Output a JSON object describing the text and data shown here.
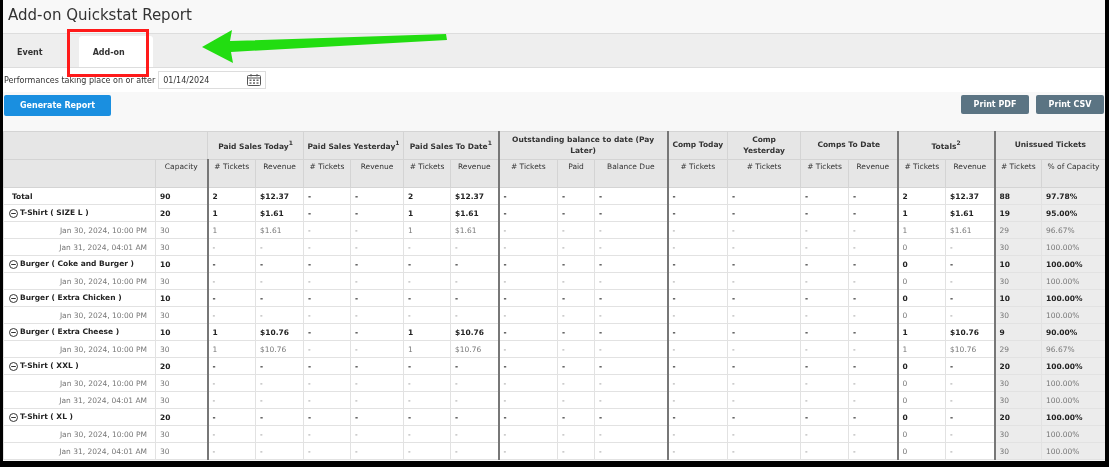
{
  "title": "Add-on Quickstat Report",
  "tabs": [
    {
      "label": "Event",
      "selected": false
    },
    {
      "label": "Add-on",
      "selected": true
    }
  ],
  "date_filter": {
    "label": "Performances taking place on or after",
    "value": "01/14/2024"
  },
  "generate_button": "Generate Report",
  "print_buttons": [
    "Print PDF",
    "Print CSV"
  ],
  "table": {
    "lead_column": "Capacity",
    "groups": [
      {
        "label": "Paid Sales Today$^{1}$",
        "columns": [
          "# Tickets",
          "Revenue"
        ]
      },
      {
        "label": "Paid Sales Yesterday$^{1}$",
        "columns": [
          "# Tickets",
          "Revenue"
        ]
      },
      {
        "label": "Paid Sales To Date$^{1}$",
        "columns": [
          "# Tickets",
          "Revenue"
        ]
      },
      {
        "label": "Outstanding balance to date (Pay Later)",
        "columns": [
          "# Tickets",
          "Paid",
          "Balance Due"
        ]
      },
      {
        "label": "Comp Today",
        "columns": [
          "# Tickets"
        ]
      },
      {
        "label": "Comp Yesterday",
        "columns": [
          "# Tickets"
        ]
      },
      {
        "label": "Comps To Date",
        "columns": [
          "# Tickets",
          "Revenue"
        ]
      },
      {
        "label": "Totals$^{2}$",
        "columns": [
          "# Tickets",
          "Revenue"
        ]
      },
      {
        "label": "Unissued Tickets",
        "columns": [
          "# Tickets",
          "% of Capacity"
        ]
      }
    ],
    "rows": [
      {
        "kind": "total",
        "name": "Total",
        "capacity": "90",
        "values": [
          "2",
          "$12.37",
          "-",
          "-",
          "2",
          "$12.37",
          "-",
          "-",
          "-",
          "-",
          "-",
          "-",
          "-",
          "2",
          "$12.37",
          "88",
          "97.78%"
        ]
      },
      {
        "kind": "item",
        "expanded": true,
        "name": "T-Shirt ( SIZE L )",
        "capacity": "20",
        "values": [
          "1",
          "$1.61",
          "-",
          "-",
          "1",
          "$1.61",
          "-",
          "-",
          "-",
          "-",
          "-",
          "-",
          "-",
          "1",
          "$1.61",
          "19",
          "95.00%"
        ]
      },
      {
        "kind": "performance",
        "name": "Jan 30, 2024, 10:00 PM",
        "capacity": "30",
        "values": [
          "1",
          "$1.61",
          "-",
          "-",
          "1",
          "$1.61",
          "-",
          "-",
          "-",
          "-",
          "-",
          "-",
          "-",
          "1",
          "$1.61",
          "29",
          "96.67%"
        ]
      },
      {
        "kind": "performance",
        "name": "Jan 31, 2024, 04:01 AM",
        "capacity": "30",
        "values": [
          "-",
          "-",
          "-",
          "-",
          "-",
          "-",
          "-",
          "-",
          "-",
          "-",
          "-",
          "-",
          "-",
          "0",
          "-",
          "30",
          "100.00%"
        ]
      },
      {
        "kind": "item",
        "expanded": true,
        "name": "Burger ( Coke and Burger )",
        "capacity": "10",
        "values": [
          "-",
          "-",
          "-",
          "-",
          "-",
          "-",
          "-",
          "-",
          "-",
          "-",
          "-",
          "-",
          "-",
          "0",
          "-",
          "10",
          "100.00%"
        ]
      },
      {
        "kind": "performance",
        "name": "Jan 30, 2024, 10:00 PM",
        "capacity": "30",
        "values": [
          "-",
          "-",
          "-",
          "-",
          "-",
          "-",
          "-",
          "-",
          "-",
          "-",
          "-",
          "-",
          "-",
          "0",
          "-",
          "30",
          "100.00%"
        ]
      },
      {
        "kind": "item",
        "expanded": true,
        "name": "Burger ( Extra Chicken )",
        "capacity": "10",
        "values": [
          "-",
          "-",
          "-",
          "-",
          "-",
          "-",
          "-",
          "-",
          "-",
          "-",
          "-",
          "-",
          "-",
          "0",
          "-",
          "10",
          "100.00%"
        ]
      },
      {
        "kind": "performance",
        "name": "Jan 30, 2024, 10:00 PM",
        "capacity": "30",
        "values": [
          "-",
          "-",
          "-",
          "-",
          "-",
          "-",
          "-",
          "-",
          "-",
          "-",
          "-",
          "-",
          "-",
          "0",
          "-",
          "30",
          "100.00%"
        ]
      },
      {
        "kind": "item",
        "expanded": true,
        "name": "Burger ( Extra Cheese )",
        "capacity": "10",
        "values": [
          "1",
          "$10.76",
          "-",
          "-",
          "1",
          "$10.76",
          "-",
          "-",
          "-",
          "-",
          "-",
          "-",
          "-",
          "1",
          "$10.76",
          "9",
          "90.00%"
        ]
      },
      {
        "kind": "performance",
        "name": "Jan 30, 2024, 10:00 PM",
        "capacity": "30",
        "values": [
          "1",
          "$10.76",
          "-",
          "-",
          "1",
          "$10.76",
          "-",
          "-",
          "-",
          "-",
          "-",
          "-",
          "-",
          "1",
          "$10.76",
          "29",
          "96.67%"
        ]
      },
      {
        "kind": "item",
        "expanded": true,
        "name": "T-Shirt ( XXL )",
        "capacity": "20",
        "values": [
          "-",
          "-",
          "-",
          "-",
          "-",
          "-",
          "-",
          "-",
          "-",
          "-",
          "-",
          "-",
          "-",
          "0",
          "-",
          "20",
          "100.00%"
        ]
      },
      {
        "kind": "performance",
        "name": "Jan 30, 2024, 10:00 PM",
        "capacity": "30",
        "values": [
          "-",
          "-",
          "-",
          "-",
          "-",
          "-",
          "-",
          "-",
          "-",
          "-",
          "-",
          "-",
          "-",
          "0",
          "-",
          "30",
          "100.00%"
        ]
      },
      {
        "kind": "performance",
        "name": "Jan 31, 2024, 04:01 AM",
        "capacity": "30",
        "values": [
          "-",
          "-",
          "-",
          "-",
          "-",
          "-",
          "-",
          "-",
          "-",
          "-",
          "-",
          "-",
          "-",
          "0",
          "-",
          "30",
          "100.00%"
        ]
      },
      {
        "kind": "item",
        "expanded": true,
        "name": "T-Shirt ( XL )",
        "capacity": "20",
        "values": [
          "-",
          "-",
          "-",
          "-",
          "-",
          "-",
          "-",
          "-",
          "-",
          "-",
          "-",
          "-",
          "-",
          "0",
          "-",
          "20",
          "100.00%"
        ]
      },
      {
        "kind": "performance",
        "name": "Jan 30, 2024, 10:00 PM",
        "capacity": "30",
        "values": [
          "-",
          "-",
          "-",
          "-",
          "-",
          "-",
          "-",
          "-",
          "-",
          "-",
          "-",
          "-",
          "-",
          "0",
          "-",
          "30",
          "100.00%"
        ]
      },
      {
        "kind": "performance",
        "name": "Jan 31, 2024, 04:01 AM",
        "capacity": "30",
        "values": [
          "-",
          "-",
          "-",
          "-",
          "-",
          "-",
          "-",
          "-",
          "-",
          "-",
          "-",
          "-",
          "-",
          "0",
          "-",
          "30",
          "100.00%"
        ]
      }
    ]
  }
}
